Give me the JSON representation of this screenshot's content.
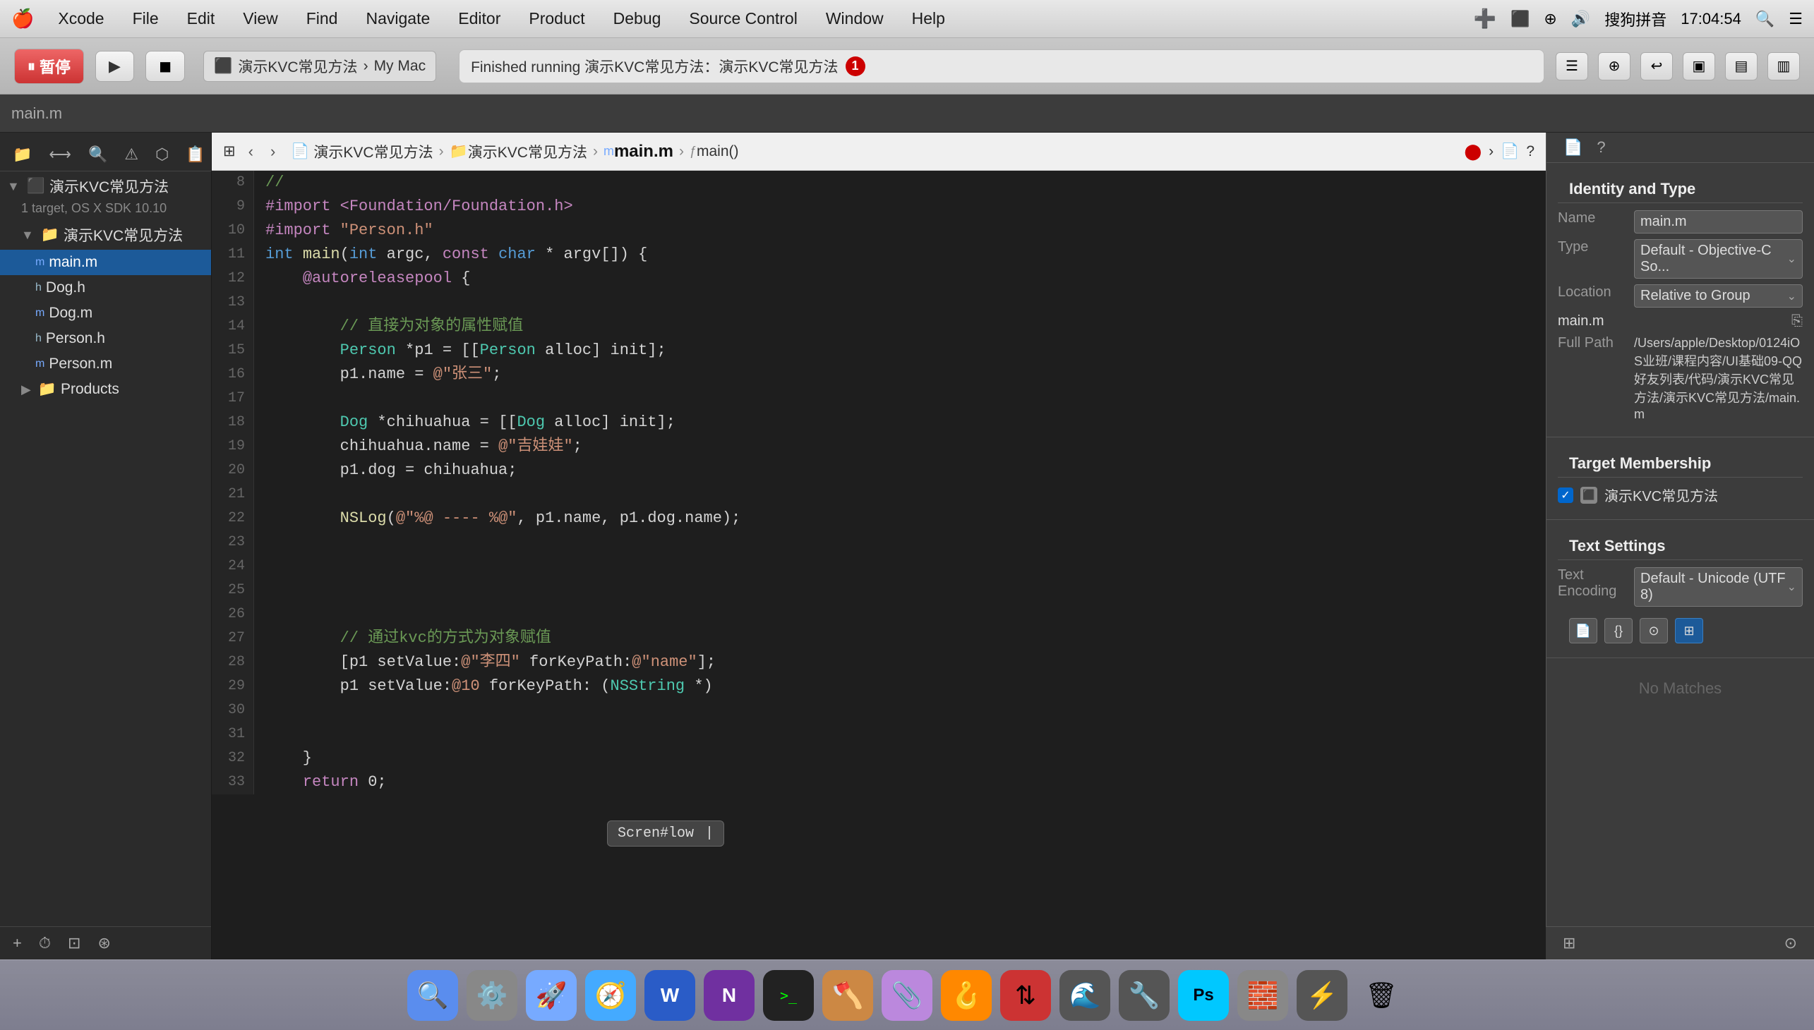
{
  "menubar": {
    "apple": "🍎",
    "items": [
      "Xcode",
      "File",
      "Edit",
      "View",
      "Find",
      "Navigate",
      "Editor",
      "Product",
      "Debug",
      "Source Control",
      "Window",
      "Help"
    ],
    "right": {
      "time": "17:04:54",
      "input_method": "搜狗拼音"
    }
  },
  "toolbar": {
    "stop_label": "暂停",
    "run_target": "演示KVC常见方法",
    "run_device": "My Mac",
    "build_status": "Finished running 演示KVC常见方法：演示KVC常见方法",
    "error_count": "1"
  },
  "tab_bar": {
    "active_tab": "main.m",
    "add_label": "+"
  },
  "breadcrumb": {
    "parts": [
      "演示KVC常见方法",
      "演示KVC常见方法",
      "main.m",
      "main()"
    ],
    "separators": [
      ">",
      ">",
      ">"
    ]
  },
  "sidebar": {
    "project_name": "演示KVC常见方法",
    "project_target": "1 target, OS X SDK 10.10",
    "group_name": "演示KVC常见方法",
    "files": [
      {
        "name": "main.m",
        "type": "m",
        "selected": true
      },
      {
        "name": "Dog.h",
        "type": "h"
      },
      {
        "name": "Dog.m",
        "type": "m"
      },
      {
        "name": "Person.h",
        "type": "h"
      },
      {
        "name": "Person.m",
        "type": "m"
      }
    ],
    "products_label": "Products"
  },
  "editor": {
    "lines": [
      {
        "num": "8",
        "content": "//",
        "tokens": [
          {
            "text": "//",
            "cls": "cmt"
          }
        ]
      },
      {
        "num": "9",
        "content": "#import <Foundation/Foundation.h>",
        "tokens": [
          {
            "text": "#import <Foundation/Foundation.h>",
            "cls": "dir"
          }
        ]
      },
      {
        "num": "10",
        "content": "#import \"Person.h\"",
        "tokens": [
          {
            "text": "#import ",
            "cls": "dir"
          },
          {
            "text": "\"Person.h\"",
            "cls": "str"
          }
        ]
      },
      {
        "num": "11",
        "content": "int main(int argc, const char * argv[]) {",
        "tokens": [
          {
            "text": "int ",
            "cls": "kw2"
          },
          {
            "text": "main",
            "cls": "fn"
          },
          {
            "text": "(",
            "cls": ""
          },
          {
            "text": "int ",
            "cls": "kw2"
          },
          {
            "text": "argc, ",
            "cls": ""
          },
          {
            "text": "const ",
            "cls": "kw"
          },
          {
            "text": "char ",
            "cls": "kw2"
          },
          {
            "text": "* argv[]) {",
            "cls": ""
          }
        ]
      },
      {
        "num": "12",
        "content": "    @autoreleasepool {",
        "tokens": [
          {
            "text": "    ",
            "cls": ""
          },
          {
            "text": "@autoreleasepool",
            "cls": "at-kw"
          },
          {
            "text": " {",
            "cls": ""
          }
        ]
      },
      {
        "num": "13",
        "content": "",
        "tokens": []
      },
      {
        "num": "14",
        "content": "        // 直接为对象的属性赋值",
        "tokens": [
          {
            "text": "        // 直接为对象的属性赋值",
            "cls": "cmt"
          }
        ]
      },
      {
        "num": "15",
        "content": "        Person *p1 = [[Person alloc] init];",
        "tokens": [
          {
            "text": "        ",
            "cls": ""
          },
          {
            "text": "Person",
            "cls": "cls"
          },
          {
            "text": " *p1 = [[",
            "cls": ""
          },
          {
            "text": "Person",
            "cls": "cls"
          },
          {
            "text": " alloc] init];",
            "cls": ""
          }
        ]
      },
      {
        "num": "16",
        "content": "        p1.name = @\"张三\";",
        "tokens": [
          {
            "text": "        p1.name = ",
            "cls": ""
          },
          {
            "text": "@\"张三\"",
            "cls": "str"
          },
          {
            "text": ";",
            "cls": ""
          }
        ]
      },
      {
        "num": "17",
        "content": "",
        "tokens": []
      },
      {
        "num": "18",
        "content": "        Dog *chihuahua = [[Dog alloc] init];",
        "tokens": [
          {
            "text": "        ",
            "cls": ""
          },
          {
            "text": "Dog",
            "cls": "cls"
          },
          {
            "text": " *chihuahua = [[",
            "cls": ""
          },
          {
            "text": "Dog",
            "cls": "cls"
          },
          {
            "text": " alloc] init];",
            "cls": ""
          }
        ]
      },
      {
        "num": "19",
        "content": "        chihuahua.name = @\"吉娃娃\";",
        "tokens": [
          {
            "text": "        chihuahua.name = ",
            "cls": ""
          },
          {
            "text": "@\"吉娃娃\"",
            "cls": "str"
          },
          {
            "text": ";",
            "cls": ""
          }
        ]
      },
      {
        "num": "20",
        "content": "        p1.dog = chihuahua;",
        "tokens": [
          {
            "text": "        p1.dog = chihuahua;",
            "cls": ""
          }
        ]
      },
      {
        "num": "21",
        "content": "",
        "tokens": []
      },
      {
        "num": "22",
        "content": "        NSLog(@\"%@ ---- %@\", p1.name, p1.dog.name);",
        "tokens": [
          {
            "text": "        ",
            "cls": ""
          },
          {
            "text": "NSLog",
            "cls": "fn"
          },
          {
            "text": "(",
            "cls": ""
          },
          {
            "text": "@\"%@ ---- %@\"",
            "cls": "str"
          },
          {
            "text": ", p1.name, p1.dog.name);",
            "cls": ""
          }
        ]
      },
      {
        "num": "23",
        "content": "",
        "tokens": []
      },
      {
        "num": "24",
        "content": "",
        "tokens": []
      },
      {
        "num": "25",
        "content": "",
        "tokens": []
      },
      {
        "num": "26",
        "content": "",
        "tokens": []
      },
      {
        "num": "27",
        "content": "        // 通过kvc的方式为对象赋值",
        "tokens": [
          {
            "text": "        // 通过kvc的方式为对象赋值",
            "cls": "cmt"
          }
        ]
      },
      {
        "num": "28",
        "content": "        [p1 setValue:@\"李四\" forKeyPath:@\"name\"];",
        "tokens": [
          {
            "text": "        [p1 setValue:",
            "cls": ""
          },
          {
            "text": "@\"李四\"",
            "cls": "str"
          },
          {
            "text": " forKeyPath:",
            "cls": ""
          },
          {
            "text": "@\"name\"",
            "cls": "str"
          },
          {
            "text": "];",
            "cls": ""
          }
        ]
      },
      {
        "num": "29",
        "content": "        p1 setValue:@10 forKeyPath: (NSString *)",
        "tokens": [
          {
            "text": "        p1 setValue:",
            "cls": ""
          },
          {
            "text": "@10",
            "cls": "str"
          },
          {
            "text": " forKeyPath: (",
            "cls": ""
          },
          {
            "text": "NSString",
            "cls": "cls"
          },
          {
            "text": " *)",
            "cls": ""
          }
        ]
      },
      {
        "num": "30",
        "content": "",
        "tokens": []
      },
      {
        "num": "31",
        "content": "",
        "tokens": []
      },
      {
        "num": "32",
        "content": "    }",
        "tokens": [
          {
            "text": "    }",
            "cls": ""
          }
        ]
      },
      {
        "num": "33",
        "content": "    return 0;",
        "tokens": [
          {
            "text": "    ",
            "cls": ""
          },
          {
            "text": "return",
            "cls": "kw"
          },
          {
            "text": " 0;",
            "cls": ""
          }
        ]
      }
    ],
    "tooltip": "Scren#low"
  },
  "right_panel": {
    "header": "Identity and Type",
    "name_label": "Name",
    "name_value": "main.m",
    "type_label": "Type",
    "type_value": "Default - Objective-C So...",
    "location_label": "Location",
    "location_value": "Relative to Group",
    "full_path_label": "Full Path",
    "full_path_value": "main.m",
    "full_path_long": "/Users/apple/Desktop/0124iOS业班/课程内容/UI基础09-QQ好友列表/代码/演示KVC常见方法/演示KVC常见方法/main.m",
    "target_header": "Target Membership",
    "target_name": "演示KVC常见方法",
    "text_settings_header": "Text Settings",
    "text_encoding_label": "Text Encoding",
    "text_encoding_value": "Default - Unicode (UTF 8)",
    "no_matches": "No Matches"
  },
  "bottom_bar": {
    "add_label": "+",
    "icons": [
      "⊕",
      "⏱",
      "⊡",
      "⊛"
    ]
  },
  "dock": {
    "items": [
      {
        "name": "finder",
        "icon": "🔍",
        "bg": "#4a9eff"
      },
      {
        "name": "system-preferences",
        "icon": "⚙️",
        "bg": "#888"
      },
      {
        "name": "launchpad",
        "icon": "🚀",
        "bg": "#7af"
      },
      {
        "name": "safari",
        "icon": "🧭",
        "bg": "#4af"
      },
      {
        "name": "office-word",
        "icon": "W",
        "bg": "#2a5cc7"
      },
      {
        "name": "onenote",
        "icon": "N",
        "bg": "#7030a0"
      },
      {
        "name": "terminal",
        "icon": ">_",
        "bg": "#333"
      },
      {
        "name": "app1",
        "icon": "🪓",
        "bg": "#555"
      },
      {
        "name": "app2",
        "icon": "📎",
        "bg": "#ff4"
      },
      {
        "name": "app3",
        "icon": "🪝",
        "bg": "#f80"
      },
      {
        "name": "filezilla",
        "icon": "⇅",
        "bg": "#c33"
      },
      {
        "name": "app4",
        "icon": "🔧",
        "bg": "#555"
      },
      {
        "name": "app5",
        "icon": "🌊",
        "bg": "#27c"
      },
      {
        "name": "photoshop",
        "icon": "Ps",
        "bg": "#00c8ff"
      },
      {
        "name": "app6",
        "icon": "🧱",
        "bg": "#aaa"
      },
      {
        "name": "app7",
        "icon": "⚡",
        "bg": "#555"
      },
      {
        "name": "trash",
        "icon": "🗑",
        "bg": "transparent"
      }
    ]
  }
}
